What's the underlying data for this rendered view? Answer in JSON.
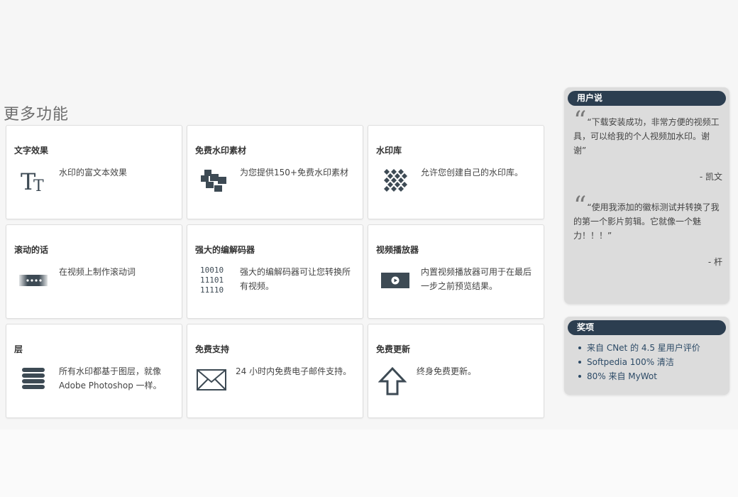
{
  "section_title": "更多功能",
  "features": [
    {
      "title": "文字效果",
      "desc": "水印的富文本效果",
      "icon": "text-tt-icon"
    },
    {
      "title": "免费水印素材",
      "desc": "为您提供150+免费水印素材",
      "icon": "puzzle-pieces-icon"
    },
    {
      "title": "水印库",
      "desc": "允许您创建自己的水印库。",
      "icon": "diamond-grid-icon"
    },
    {
      "title": "滚动的话",
      "desc": "在视频上制作滚动词",
      "icon": "scrolling-text-icon"
    },
    {
      "title": "强大的编解码器",
      "desc": "强大的编解码器可让您转换所有视频。",
      "icon": "binary-code-icon",
      "code_lines": [
        "10010",
        "11101",
        "11110"
      ]
    },
    {
      "title": "视频播放器",
      "desc": "内置视频播放器可用于在最后一步之前预览结果。",
      "icon": "video-player-icon"
    },
    {
      "title": "层",
      "desc": "所有水印都基于图层，就像 Adobe Photoshop 一样。",
      "icon": "layers-stack-icon"
    },
    {
      "title": "免费支持",
      "desc": "24 小时内免费电子邮件支持。",
      "icon": "envelope-icon"
    },
    {
      "title": "免费更新",
      "desc": "终身免费更新。",
      "icon": "up-arrow-icon"
    }
  ],
  "testimonials": {
    "header": "用户说",
    "items": [
      {
        "text": "“下载安装成功，非常方便的视频工具，可以给我的个人视频加水印。谢谢”",
        "author": "- 凯文"
      },
      {
        "text": "“使用我添加的徽标测试并转换了我的第一个影片剪辑。它就像一个魅力！！！”",
        "author": "- 杆"
      }
    ]
  },
  "awards": {
    "header": "奖项",
    "items": [
      "来自 CNet 的 4.5 星用户评价",
      "Softpedia 100% 清洁",
      "80% 来自 MyWot"
    ]
  },
  "colors": {
    "header_bg": "#2c3e50",
    "icon": "#3d4a54",
    "award_text": "#2c4a66"
  }
}
